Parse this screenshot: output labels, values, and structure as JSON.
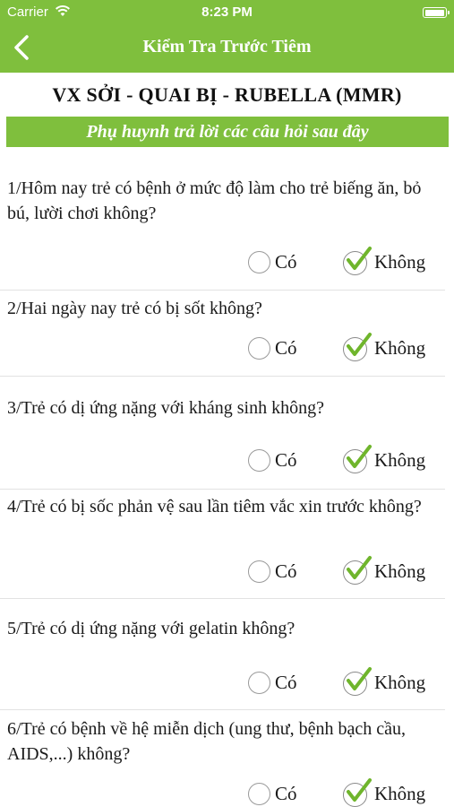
{
  "status_bar": {
    "carrier": "Carrier",
    "time": "8:23 PM",
    "battery_level": 1.0
  },
  "nav": {
    "title": "Kiểm Tra Trước Tiêm",
    "back_icon": "chevron-left-icon"
  },
  "form": {
    "title": "VX SỞI - QUAI BỊ - RUBELLA (MMR)",
    "banner": "Phụ huynh trả lời các câu hỏi sau đây",
    "yes_label": "Có",
    "no_label": "Không",
    "questions": [
      {
        "text": "1/Hôm nay trẻ có bệnh ở mức độ làm cho trẻ biếng ăn, bỏ bú, lười chơi không?",
        "answer": "Không"
      },
      {
        "text": "2/Hai ngày nay trẻ có bị sốt không?",
        "answer": "Không"
      },
      {
        "text": "3/Trẻ có dị ứng nặng với kháng sinh không?",
        "answer": "Không"
      },
      {
        "text": "4/Trẻ có bị sốc phản vệ sau lần tiêm vắc xin trước không?",
        "answer": "Không"
      },
      {
        "text": "5/Trẻ có dị ứng nặng với gelatin không?",
        "answer": "Không"
      },
      {
        "text": "6/Trẻ có bệnh về hệ miễn dịch (ung thư, bệnh bạch cầu, AIDS,...) không?",
        "answer": "Không"
      }
    ]
  },
  "colors": {
    "brand_green": "#7fbf3d",
    "check_green": "#6fb52c"
  }
}
